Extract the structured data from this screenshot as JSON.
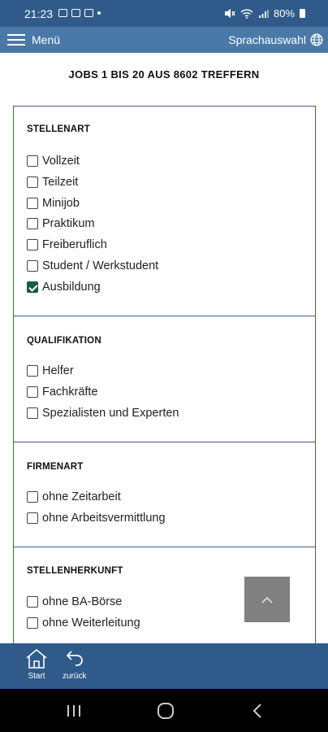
{
  "status_bar": {
    "time": "21:23",
    "battery": "80%"
  },
  "app_bar": {
    "menu_label": "Menü",
    "language_label": "Sprachauswahl"
  },
  "results_title": "JOBS 1 BIS 20 AUS 8602 TREFFERN",
  "filters": [
    {
      "title": "STELLENART",
      "options": [
        {
          "label": "Vollzeit",
          "checked": false
        },
        {
          "label": "Teilzeit",
          "checked": false
        },
        {
          "label": "Minijob",
          "checked": false
        },
        {
          "label": "Praktikum",
          "checked": false
        },
        {
          "label": "Freiberuflich",
          "checked": false
        },
        {
          "label": "Student / Werkstudent",
          "checked": false
        },
        {
          "label": "Ausbildung",
          "checked": true
        }
      ]
    },
    {
      "title": "QUALIFIKATION",
      "options": [
        {
          "label": "Helfer",
          "checked": false
        },
        {
          "label": "Fachkräfte",
          "checked": false
        },
        {
          "label": "Spezialisten und Experten",
          "checked": false
        }
      ]
    },
    {
      "title": "FIRMENART",
      "options": [
        {
          "label": "ohne Zeitarbeit",
          "checked": false
        },
        {
          "label": "ohne Arbeitsvermittlung",
          "checked": false
        }
      ]
    },
    {
      "title": "STELLENHERKUNFT",
      "options": [
        {
          "label": "ohne BA-Börse",
          "checked": false
        },
        {
          "label": "ohne Weiterleitung",
          "checked": false
        }
      ]
    }
  ],
  "bottom_nav": {
    "start_label": "Start",
    "back_label": "zurück"
  },
  "colors": {
    "status_bar": "#305a8a",
    "app_bar": "#4a79a8",
    "border": "#3a5f89",
    "checked": "#1a5a4a"
  }
}
